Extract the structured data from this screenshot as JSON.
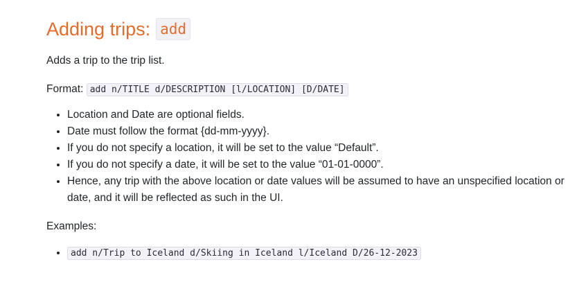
{
  "heading": {
    "title": "Adding trips:",
    "command": "add"
  },
  "description": "Adds a trip to the trip list.",
  "format": {
    "label": "Format:",
    "syntax": "add n/TITLE d/DESCRIPTION [l/LOCATION] [D/DATE]"
  },
  "notes": [
    "Location and Date are optional fields.",
    "Date must follow the format {dd-mm-yyyy}.",
    "If you do not specify a location, it will be set to the value “Default”.",
    "If you do not specify a date, it will be set to the value “01-01-0000”.",
    "Hence, any trip with the above location or date values will be assumed to have an unspecified location or date, and it will be reflected as such in the UI."
  ],
  "examples": {
    "label": "Examples:",
    "items": [
      "add n/Trip to Iceland d/Skiing in Iceland l/Iceland D/26-12-2023"
    ]
  }
}
